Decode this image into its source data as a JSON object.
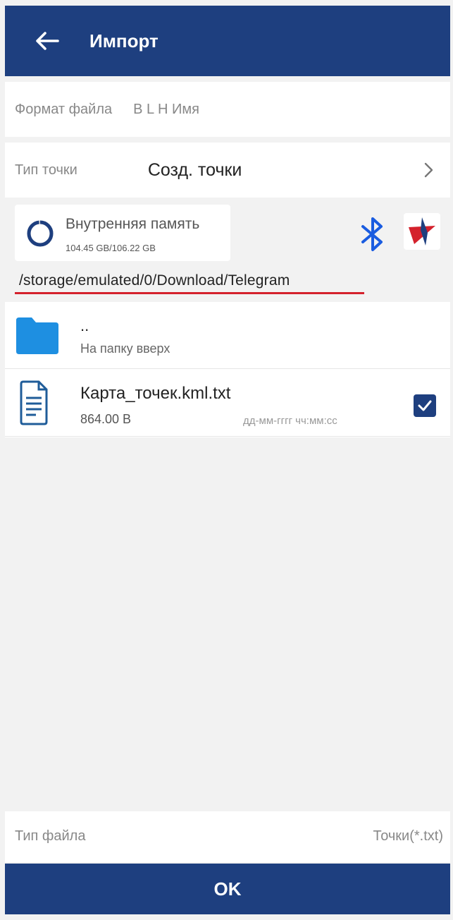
{
  "appbar": {
    "title": "Импорт",
    "back_icon": "arrow-left-icon"
  },
  "file_format": {
    "label": "Формат файла",
    "value": "B L H Имя"
  },
  "point_type": {
    "label": "Тип точки",
    "value": "Созд. точки",
    "icon": "chevron-right-icon"
  },
  "storage": {
    "name": "Внутренняя память",
    "size": "104.45 GB/106.22 GB",
    "used_fraction": 0.983,
    "path": "/storage/emulated/0/Download/Telegram",
    "bluetooth_icon": "bluetooth-icon",
    "star_icon": "star-app-icon"
  },
  "list": {
    "up_item": {
      "dots": "..",
      "label": "На папку вверх",
      "icon": "folder-icon"
    },
    "files": [
      {
        "name": "Карта_точек.kml.txt",
        "size": "864.00 B",
        "date": "дд-мм-гггг чч:мм:сс",
        "checked": true,
        "icon": "document-icon"
      }
    ]
  },
  "file_type": {
    "label": "Тип файла",
    "value": "Точки(*.txt)"
  },
  "ok": {
    "label": "OK"
  },
  "colors": {
    "primary": "#1e3f7f",
    "accent_red": "#d4212c",
    "folder": "#1e8fe1",
    "bluetooth": "#1a5ce0"
  }
}
